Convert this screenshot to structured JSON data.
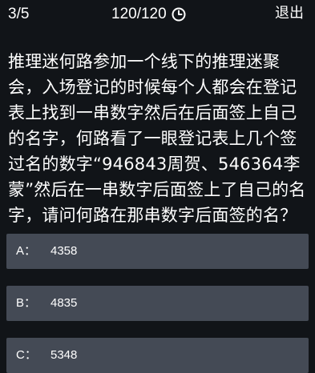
{
  "header": {
    "progress": "3/5",
    "timer": "120/120",
    "exit_label": "退出"
  },
  "question": {
    "text": "推理迷何路参加一个线下的推理迷聚会，入场登记的时候每个人都会在登记表上找到一串数字然后在后面签上自己的名字，何路看了一眼登记表上几个签过名的数字“946843周贺、546364李蒙”然后在一串数字后面签上了自己的名字，请问何路在那串数字后面签的名？"
  },
  "options": [
    {
      "letter": "A：",
      "value": "4358"
    },
    {
      "letter": "B：",
      "value": "4835"
    },
    {
      "letter": "C：",
      "value": "5348"
    }
  ],
  "icons": {
    "timer": "clock-icon"
  },
  "colors": {
    "background": "#111418",
    "option_background": "#444a55",
    "text": "#ffffff"
  }
}
